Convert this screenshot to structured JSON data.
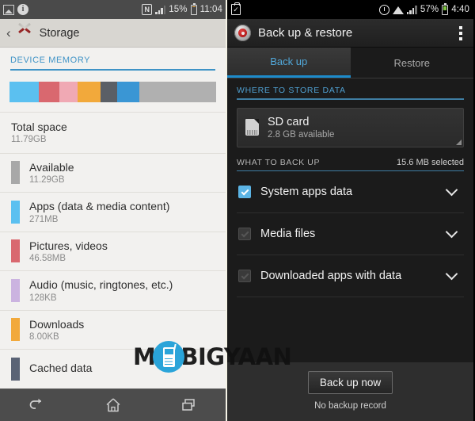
{
  "left_phone": {
    "status_bar": {
      "icons": [
        "image-icon",
        "info-icon",
        "nfc-icon",
        "signal-icon"
      ],
      "battery_percent": "15%",
      "time": "11:04"
    },
    "action_bar": {
      "back_label": "‹",
      "icon": "tools-icon",
      "title": "Storage"
    },
    "section_header": "DEVICE MEMORY",
    "usage_bar_segments": [
      {
        "name": "apps",
        "color": "#5bc0f0",
        "percent": 14
      },
      {
        "name": "pictures-videos",
        "color": "#d9686f",
        "percent": 10
      },
      {
        "name": "misc-pink",
        "color": "#f0a9b4",
        "percent": 9
      },
      {
        "name": "downloads",
        "color": "#f2a93b",
        "percent": 11
      },
      {
        "name": "cached-data",
        "color": "#5a5f66",
        "percent": 8
      },
      {
        "name": "audio-blue",
        "color": "#3a96d4",
        "percent": 11
      },
      {
        "name": "available",
        "color": "#b0b0b0",
        "percent": 37
      }
    ],
    "total": {
      "title": "Total space",
      "value": "11.79GB"
    },
    "items": [
      {
        "title": "Available",
        "value": "11.29GB",
        "color": "#a8a8a8"
      },
      {
        "title": "Apps (data & media content)",
        "value": "271MB",
        "color": "#5bc0f0"
      },
      {
        "title": "Pictures, videos",
        "value": "46.58MB",
        "color": "#d9686f"
      },
      {
        "title": "Audio (music, ringtones, etc.)",
        "value": "128KB",
        "color": "#cbb3e0"
      },
      {
        "title": "Downloads",
        "value": "8.00KB",
        "color": "#f2a93b"
      },
      {
        "title": "Cached data",
        "value": "",
        "color": "#5a6375"
      }
    ],
    "nav": {
      "back": "back-icon",
      "home": "home-icon",
      "recents": "recents-icon"
    }
  },
  "right_phone": {
    "status_bar": {
      "icons": [
        "clipboard-icon",
        "alarm-icon",
        "wifi-icon",
        "signal-icon"
      ],
      "battery_percent": "57%",
      "time": "4:40"
    },
    "action_bar": {
      "icon": "lifesaver-icon",
      "title": "Back up & restore",
      "overflow": "overflow-menu-icon"
    },
    "tabs": [
      {
        "label": "Back up",
        "active": true
      },
      {
        "label": "Restore",
        "active": false
      }
    ],
    "where_to_store": {
      "header": "WHERE TO STORE DATA",
      "card": {
        "title": "SD card",
        "subtitle": "2.8 GB available",
        "icon": "sd-card-icon"
      }
    },
    "what_to_back_up": {
      "header": "WHAT TO BACK UP",
      "selected": "15.6 MB selected",
      "rows": [
        {
          "label": "System apps data",
          "checked": true
        },
        {
          "label": "Media files",
          "checked": false
        },
        {
          "label": "Downloaded apps with data",
          "checked": false
        }
      ]
    },
    "footer": {
      "button": "Back up now",
      "status": "No backup record"
    },
    "nav": {
      "back": "back-icon",
      "home": "home-icon",
      "recents": "recents-icon"
    }
  },
  "watermark": {
    "prefix": "M",
    "suffix": "BIGYAAN",
    "logo_color": "#1b9fd8"
  },
  "colors": {
    "accent_blue": "#3f93c6",
    "dark_accent": "#51a8da"
  }
}
